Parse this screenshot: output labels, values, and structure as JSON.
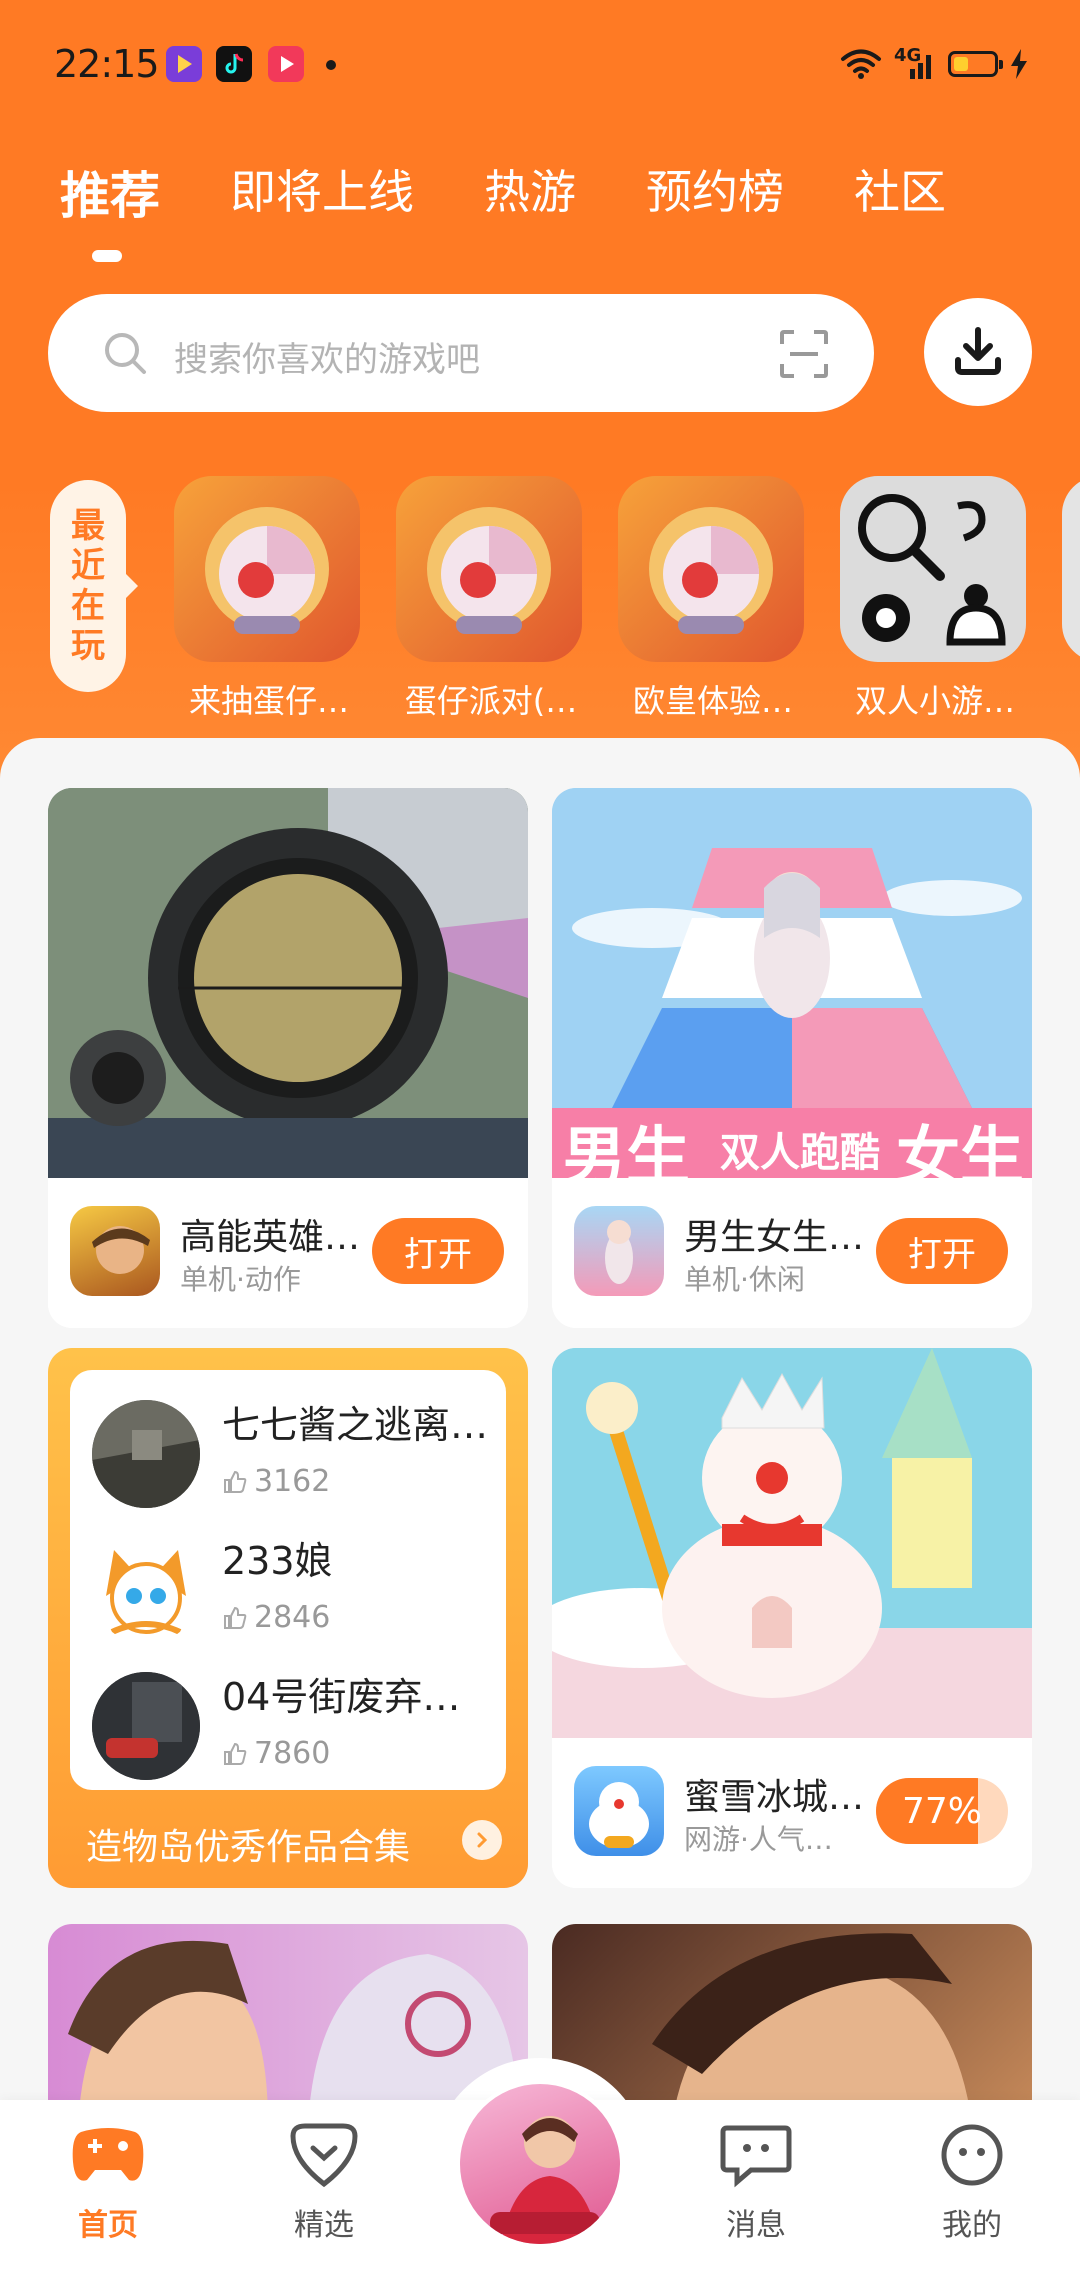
{
  "status_bar": {
    "time": "22:15",
    "network": "4G",
    "battery_percent": 45,
    "app_icons": [
      "app-icon-purple",
      "tiktok-icon",
      "video-app-icon"
    ]
  },
  "tabs": [
    {
      "label": "推荐",
      "active": true
    },
    {
      "label": "即将上线",
      "active": false
    },
    {
      "label": "热游",
      "active": false
    },
    {
      "label": "预约榜",
      "active": false
    },
    {
      "label": "社区",
      "active": false
    }
  ],
  "search": {
    "placeholder": "搜索你喜欢的游戏吧",
    "icons": [
      "search-icon",
      "scan-icon",
      "download-icon"
    ]
  },
  "recent": {
    "label_chars": [
      "最",
      "近",
      "在",
      "玩"
    ],
    "items": [
      {
        "name": "来抽蛋仔…"
      },
      {
        "name": "蛋仔派对(…"
      },
      {
        "name": "欧皇体验…"
      },
      {
        "name": "双人小游…"
      }
    ]
  },
  "cards": {
    "card1": {
      "name": "高能英雄…",
      "tags": "单机·动作",
      "action": "打开"
    },
    "card2": {
      "name": "男生女生…",
      "tags": "单机·休闲",
      "action": "打开",
      "banner_left": "男生",
      "banner_mid": "双人跑酷",
      "banner_right": "女生"
    },
    "card3": {
      "name": "蜜雪冰城…",
      "tags": "网游·人气…",
      "progress_label": "77%",
      "progress": 0.77
    }
  },
  "collection": {
    "items": [
      {
        "title": "七七酱之逃离…",
        "likes": "3162"
      },
      {
        "title": "233娘",
        "likes": "2846"
      },
      {
        "title": "04号街废弃…",
        "likes": "7860"
      }
    ],
    "footer": "造物岛优秀作品合集"
  },
  "bottom_nav": [
    {
      "label": "首页",
      "icon": "gamepad-icon",
      "active": true
    },
    {
      "label": "精选",
      "icon": "heart-icon",
      "active": false
    },
    {
      "label": "",
      "icon": "avatar",
      "active": false
    },
    {
      "label": "消息",
      "icon": "message-icon",
      "active": false
    },
    {
      "label": "我的",
      "icon": "profile-icon",
      "active": false
    }
  ],
  "colors": {
    "brand": "#ff7a24",
    "brand_light": "#ffd9bd",
    "text_primary": "#222222",
    "text_secondary": "#999999"
  }
}
